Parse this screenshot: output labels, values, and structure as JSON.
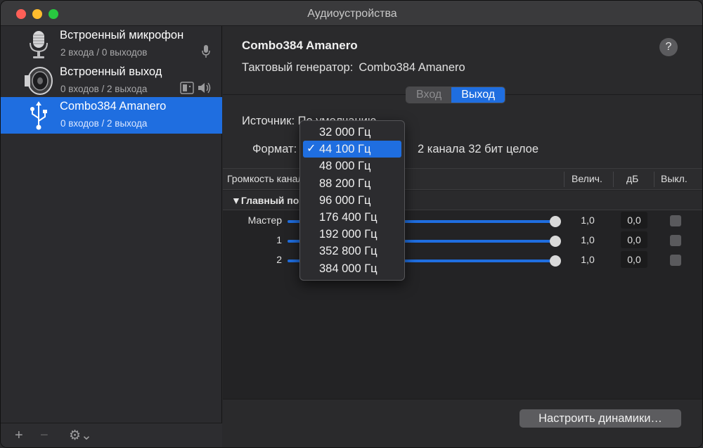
{
  "window": {
    "title": "Аудиоустройства"
  },
  "devices": [
    {
      "name": "Встроенный микрофон",
      "sub": "2 входа / 0 выходов",
      "icon": "microphone-icon"
    },
    {
      "name": "Встроенный выход",
      "sub": "0 входов / 2 выхода",
      "icon": "speaker-icon"
    },
    {
      "name": "Combo384 Amanero",
      "sub": "0 входов / 2 выхода",
      "icon": "usb-icon",
      "selected": true
    }
  ],
  "sidebar_footer": {
    "add": "+",
    "remove": "−",
    "gear": "⚙⌄"
  },
  "main": {
    "device_title": "Combo384 Amanero",
    "help": "?",
    "clock_label": "Тактовый генератор:",
    "clock_value": "Combo384 Amanero",
    "tabs": {
      "input": "Вход",
      "output": "Выход",
      "selected": "Выход"
    },
    "source_label": "Источник: По умолчанию",
    "format_label": "Формат:",
    "format_desc": "2 канала 32 бит целое",
    "table": {
      "col_volume": "Громкость канала",
      "col_value": "Величина",
      "col_value_short": "Велич.",
      "col_db": "дБ",
      "col_mute": "Выкл.",
      "group": "Главный поток",
      "group_visible": "▼Главный по",
      "rows": [
        {
          "label": "Мастер",
          "value": "1,0",
          "db": "0,0",
          "level": 1.0
        },
        {
          "label": "1",
          "value": "1,0",
          "db": "0,0",
          "level": 1.0
        },
        {
          "label": "2",
          "value": "1,0",
          "db": "0,0",
          "level": 1.0
        }
      ]
    },
    "configure_speakers": "Настроить динамики…"
  },
  "format_popup": {
    "selected": "44 100 Гц",
    "options": [
      "32 000 Гц",
      "44 100 Гц",
      "48 000 Гц",
      "88 200 Гц",
      "96 000 Гц",
      "176 400 Гц",
      "192 000 Гц",
      "352 800 Гц",
      "384 000 Гц"
    ],
    "check": "✓"
  },
  "colors": {
    "accent": "#1f6ee0",
    "window_bg": "#2a2a2c"
  }
}
